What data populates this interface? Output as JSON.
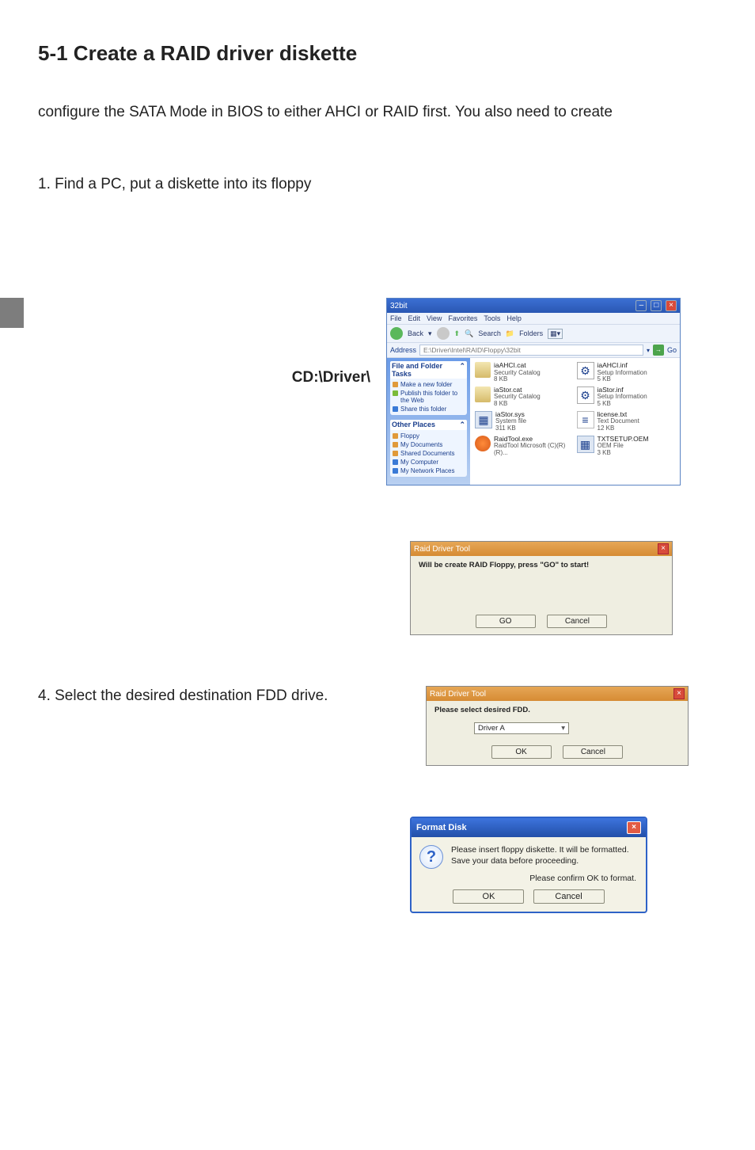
{
  "heading": "5-1 Create a RAID driver diskette",
  "intro": "configure the SATA Mode in BIOS to either AHCI or RAID first. You also need to create",
  "step1": "1. Find a PC, put a diskette into its floppy",
  "cd_path": "CD:\\Driver\\",
  "step4": "4. Select the desired destination FDD drive.",
  "explorer": {
    "title": "32bit",
    "menu": [
      "File",
      "Edit",
      "View",
      "Favorites",
      "Tools",
      "Help"
    ],
    "toolbar": {
      "back": "Back",
      "search": "Search",
      "folders": "Folders"
    },
    "address_label": "Address",
    "address": "E:\\Driver\\Intel\\RAID\\Floppy\\32bit",
    "go": "Go",
    "tasks_header": "File and Folder Tasks",
    "tasks": [
      "Make a new folder",
      "Publish this folder to the Web",
      "Share this folder"
    ],
    "other_header": "Other Places",
    "other": [
      "Floppy",
      "My Documents",
      "Shared Documents",
      "My Computer",
      "My Network Places"
    ],
    "files": [
      {
        "name": "iaAHCI.cat",
        "sub": "Security Catalog",
        "size": "8 KB",
        "type": "cat"
      },
      {
        "name": "iaAHCI.inf",
        "sub": "Setup Information",
        "size": "5 KB",
        "type": "inf"
      },
      {
        "name": "iaStor.cat",
        "sub": "Security Catalog",
        "size": "8 KB",
        "type": "cat"
      },
      {
        "name": "iaStor.inf",
        "sub": "Setup Information",
        "size": "5 KB",
        "type": "inf"
      },
      {
        "name": "iaStor.sys",
        "sub": "System file",
        "size": "311 KB",
        "type": "sys"
      },
      {
        "name": "license.txt",
        "sub": "Text Document",
        "size": "12 KB",
        "type": "txt"
      },
      {
        "name": "RaidTool.exe",
        "sub": "RaidTool Microsoft (C)(R)(R)...",
        "size": "",
        "type": "exe"
      },
      {
        "name": "TXTSETUP.OEM",
        "sub": "OEM File",
        "size": "3 KB",
        "type": "sys"
      }
    ]
  },
  "dlg1": {
    "title": "Raid Driver Tool",
    "msg": "Will be create RAID Floppy, press \"GO\" to start!",
    "go": "GO",
    "cancel": "Cancel"
  },
  "dlg2": {
    "title": "Raid Driver Tool",
    "msg": "Please select desired FDD.",
    "drive": "Driver A",
    "ok": "OK",
    "cancel": "Cancel"
  },
  "dlg3": {
    "title": "Format Disk",
    "msg": "Please insert floppy diskette.  It will be formatted. Save your data before proceeding.",
    "confirm": "Please confirm OK to format.",
    "ok": "OK",
    "cancel": "Cancel"
  }
}
